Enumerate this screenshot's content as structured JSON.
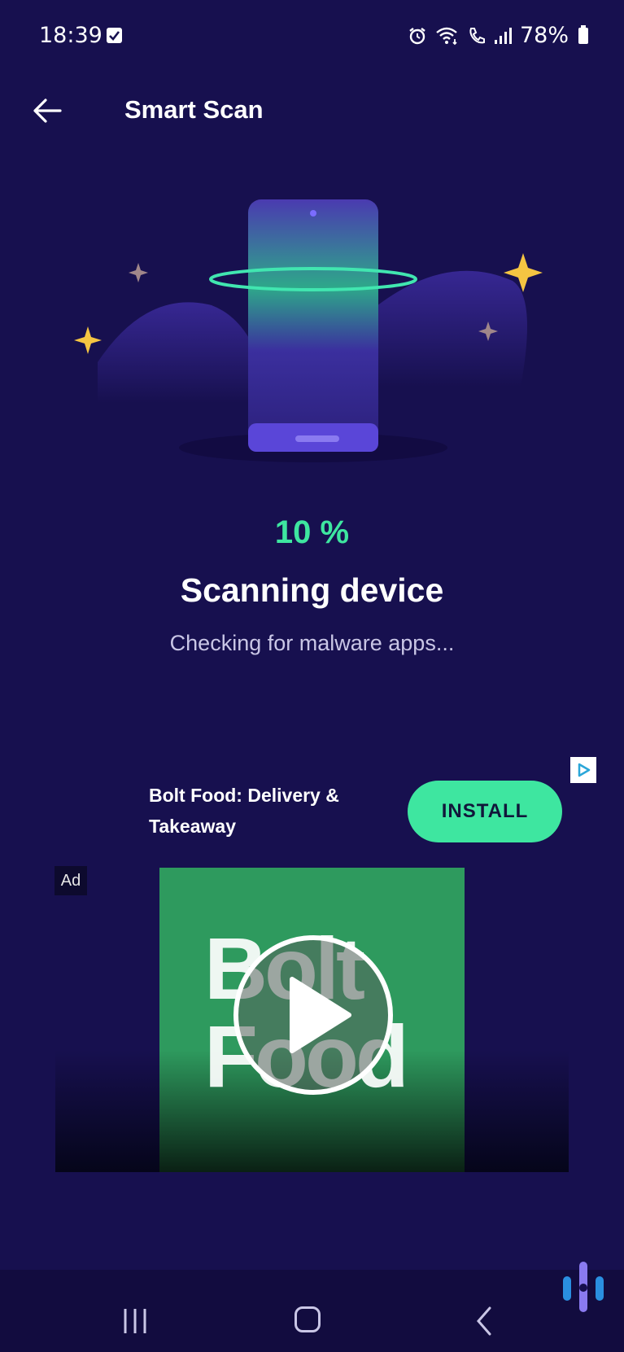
{
  "status_bar": {
    "time": "18:39",
    "battery": "78%",
    "icons": [
      "checkbox-icon",
      "alarm-icon",
      "wifi-call-icon",
      "phone-icon",
      "signal-icon",
      "battery-icon"
    ]
  },
  "header": {
    "title": "Smart Scan",
    "back_icon": "arrow-left-icon"
  },
  "scan": {
    "progress_text": "10 %",
    "progress_value": 10,
    "title": "Scanning device",
    "subtitle": "Checking for malware apps..."
  },
  "ad": {
    "app_name": "Bolt Food: Delivery & Takeaway",
    "install_label": "INSTALL",
    "badge": "Ad",
    "poster_text_line1": "Bolt",
    "poster_text_line2": "Food"
  },
  "nav": {
    "icons": [
      "recents-icon",
      "home-icon",
      "back-icon"
    ]
  },
  "colors": {
    "background": "#17104f",
    "accent": "#3ee6a0",
    "poster": "#2e9a5e"
  }
}
